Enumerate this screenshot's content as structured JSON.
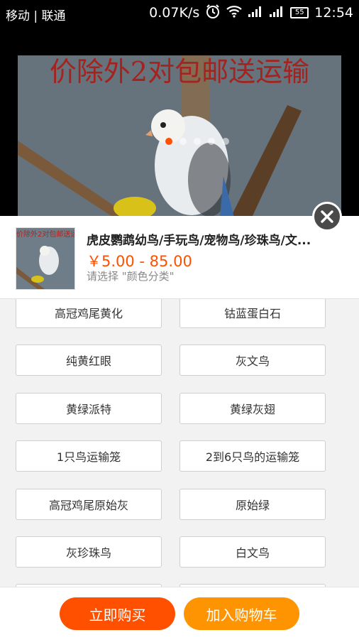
{
  "status_bar": {
    "carriers": "移动 | 联通",
    "speed": "0.07K/s",
    "battery": "55",
    "time": "12:54"
  },
  "banner": {
    "caption": "价除外2对包邮送运输",
    "carousel_count": 5,
    "active_index": 0
  },
  "product": {
    "thumb_caption": "价除外2对包邮送运",
    "title": "虎皮鹦鹉幼鸟/手玩鸟/宠物鸟/珍珠鸟/文...",
    "price": "￥5.00 - 85.00",
    "hint": "请选择 \"颜色分类\""
  },
  "options": [
    "高冠鸡尾黄化",
    "钴蓝蛋白石",
    "纯黄红眼",
    "灰文鸟",
    "黄绿派特",
    "黄绿灰翅",
    "1只鸟运输笼",
    "2到6只鸟的运输笼",
    "高冠鸡尾原始灰",
    "原始绿",
    "灰珍珠鸟",
    "白文鸟",
    "",
    ""
  ],
  "actions": {
    "buy_now": "立即购买",
    "add_to_cart": "加入购物车"
  },
  "colors": {
    "accent": "#ff5000",
    "cart": "#ff9402"
  }
}
